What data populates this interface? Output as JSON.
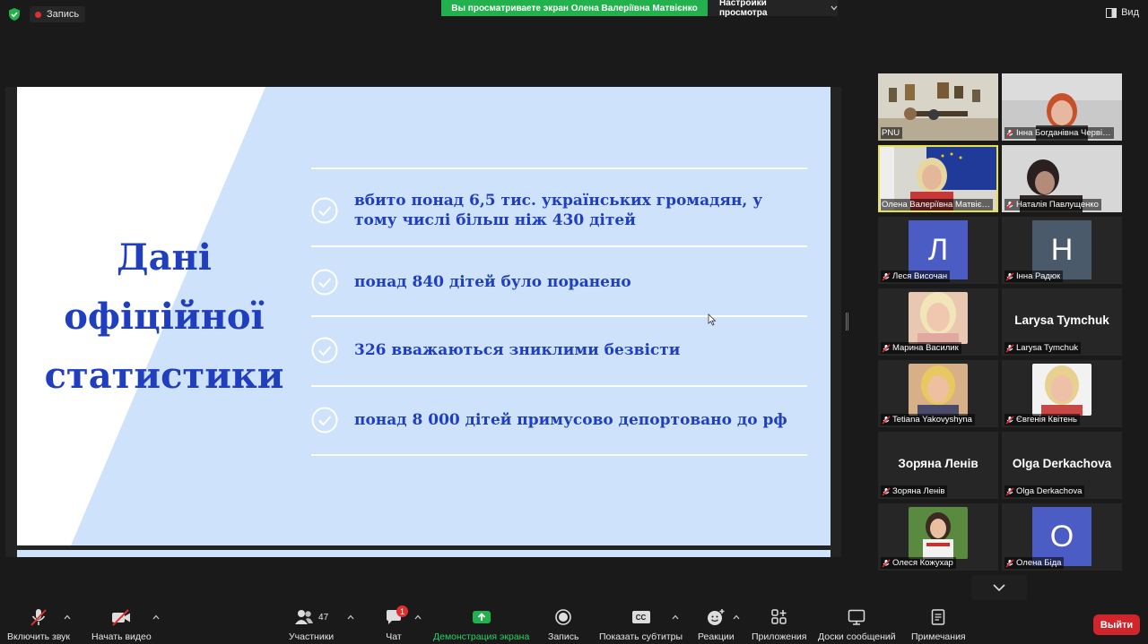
{
  "topbar": {
    "recording_label": "Запись",
    "share_banner": "Вы просматриваете экран Олена Валеріївна Матвієнко",
    "view_settings_label": "Настройки просмотра",
    "view_label": "Вид"
  },
  "slide": {
    "title_lines": [
      "Дані",
      "офіційної",
      "статистики"
    ],
    "items": [
      "вбито понад 6,5 тис. українських громадян, у тому числі більш ніж 430 дітей",
      "понад 840 дітей було поранено",
      "326 вважаються зниклими безвісти",
      "понад 8 000 дітей примусово депортовано до рф"
    ]
  },
  "gallery": {
    "tiles": [
      {
        "name": "PNU",
        "muted": false,
        "kind": "video"
      },
      {
        "name": "Інна Богданівна Черві…",
        "muted": true,
        "kind": "video"
      },
      {
        "name": "Олена Валеріївна Матвіє…",
        "muted": false,
        "kind": "video",
        "active": true
      },
      {
        "name": "Наталія Павлущенко",
        "muted": true,
        "kind": "video"
      },
      {
        "name": "Леся Височан",
        "muted": true,
        "kind": "letter",
        "letter": "Л",
        "color": "#4b5dc4"
      },
      {
        "name": "Інна Радюк",
        "muted": true,
        "kind": "letter",
        "letter": "Н",
        "color": "#4a5a6a"
      },
      {
        "name": "Марина Василик",
        "muted": true,
        "kind": "photo"
      },
      {
        "name": "Larysa Tymchuk",
        "muted": true,
        "kind": "text",
        "big": "Larysa Tymchuk"
      },
      {
        "name": "Tetiana Yakovyshyna",
        "muted": true,
        "kind": "photo"
      },
      {
        "name": "Євгенія Квітень",
        "muted": true,
        "kind": "photo"
      },
      {
        "name": "Зоряна Ленів",
        "muted": true,
        "kind": "text",
        "big": "Зоряна Ленів"
      },
      {
        "name": "Olga Derkachova",
        "muted": true,
        "kind": "text",
        "big": "Olga Derkachova"
      },
      {
        "name": "Олеся Кожухар",
        "muted": true,
        "kind": "photo"
      },
      {
        "name": "Олена Біда",
        "muted": true,
        "kind": "letter",
        "letter": "О",
        "color": "#4b5dc4"
      }
    ]
  },
  "toolbar": {
    "mute": "Включить звук",
    "video": "Начать видео",
    "participants": "Участники",
    "participants_count": "47",
    "chat": "Чат",
    "chat_badge": "1",
    "share": "Демонстрация экрана",
    "record": "Запись",
    "captions": "Показать субтитры",
    "captions_icon": "CC",
    "reactions": "Реакции",
    "apps": "Приложения",
    "whiteboards": "Доски сообщений",
    "notes": "Примечания",
    "leave": "Выйти"
  },
  "colors": {
    "share_green": "#22b14c",
    "slide_blue": "#1f3fbf",
    "slide_bg": "#cfe2fb",
    "leave_red": "#d0262b",
    "active_speaker": "#e8e14a"
  }
}
